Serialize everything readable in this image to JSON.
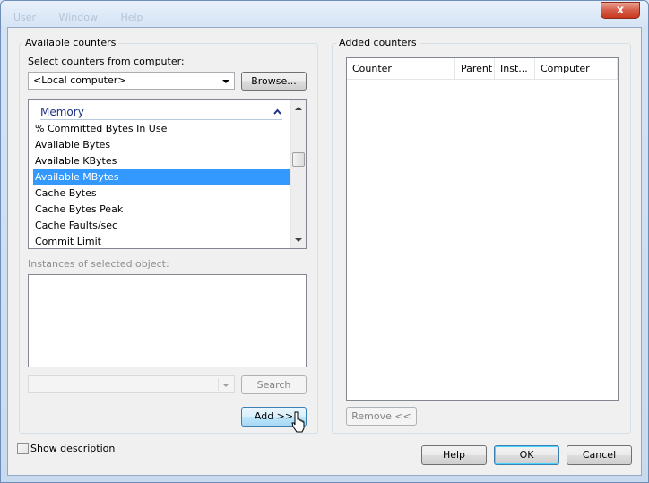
{
  "titlebar": {
    "menu": [
      "User",
      "Window",
      "Help"
    ],
    "close_label": "x"
  },
  "available": {
    "legend": "Available counters",
    "select_label": "Select counters from computer:",
    "computer_value": "<Local computer>",
    "browse_label": "Browse...",
    "category": "Memory",
    "counters": [
      {
        "label": "% Committed Bytes In Use",
        "selected": false
      },
      {
        "label": "Available Bytes",
        "selected": false
      },
      {
        "label": "Available KBytes",
        "selected": false
      },
      {
        "label": "Available MBytes",
        "selected": true
      },
      {
        "label": "Cache Bytes",
        "selected": false
      },
      {
        "label": "Cache Bytes Peak",
        "selected": false
      },
      {
        "label": "Cache Faults/sec",
        "selected": false
      },
      {
        "label": "Commit Limit",
        "selected": false
      }
    ],
    "instances_label": "Instances of selected object:",
    "search_label": "Search",
    "add_label": "Add >>"
  },
  "added": {
    "legend": "Added counters",
    "columns": [
      "Counter",
      "Parent",
      "Inst...",
      "Computer"
    ],
    "remove_label": "Remove <<"
  },
  "footer": {
    "show_description": "Show description",
    "help_label": "Help",
    "ok_label": "OK",
    "cancel_label": "Cancel"
  },
  "colors": {
    "selection": "#3399ff",
    "category_text": "#1e3287",
    "close_red": "#c8391f"
  }
}
